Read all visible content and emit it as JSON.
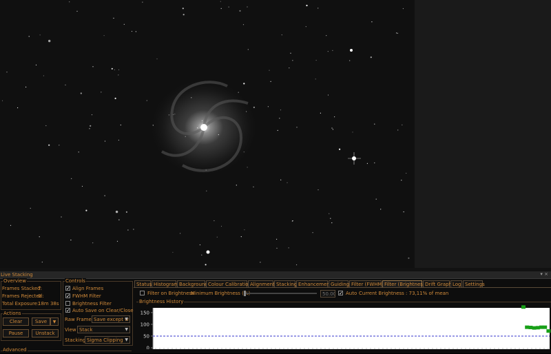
{
  "panel": {
    "title": "Live Stacking",
    "controls": "▾ ×"
  },
  "overview": {
    "title": "Overview",
    "frames_stacked_label": "Frames Stacked:",
    "frames_stacked": "7",
    "frames_rejected_label": "Frames Rejected:",
    "frames_rejected": "0",
    "total_exposure_label": "Total Exposure:",
    "total_exposure": "18m 38s"
  },
  "actions": {
    "title": "Actions",
    "clear": "Clear",
    "save": "Save",
    "pause": "Pause",
    "unstack": "Unstack"
  },
  "advanced": {
    "title": "Advanced"
  },
  "controls": {
    "title": "Controls",
    "checks": [
      {
        "label": "Align Frames",
        "checked": true
      },
      {
        "label": "FWHM Filter",
        "checked": true
      },
      {
        "label": "Brightness Filter",
        "checked": false
      },
      {
        "label": "Auto Save on Clear/Close",
        "checked": true
      }
    ],
    "raw_frames_label": "Raw Frames",
    "raw_frames_value": "Save except w",
    "view_label": "View",
    "view_value": "Stack",
    "stacking_label": "Stacking",
    "stacking_value": "Sigma Clipping"
  },
  "tabs": [
    "Status",
    "Histogram",
    "Background",
    "Colour Calibration",
    "Alignment",
    "Stacking",
    "Enhancement",
    "Guiding",
    "Filter (FWHM)",
    "Filter (Brightness)",
    "Drift Graph",
    "Log",
    "Settings"
  ],
  "active_tab": "Filter (Brightness)",
  "filter": {
    "filter_on_label": "Filter on Brightness",
    "filter_on_checked": false,
    "min_label": "Minimum Brightness (%)",
    "min_value": "50.00",
    "auto_label": "Auto",
    "auto_checked": true,
    "current": "Current Brightness : 73,11% of mean"
  },
  "history": {
    "title": "Brightness History"
  },
  "chart_data": {
    "type": "scatter",
    "title": "Brightness History",
    "xlabel": "",
    "ylabel": "",
    "y_ticks": [
      "150",
      "100",
      "50",
      "0"
    ],
    "ylim": [
      0,
      170
    ],
    "threshold": 50,
    "threshold_color": "#3333cc",
    "point_color": "#18a018",
    "series": [
      {
        "x": [
          0,
          1,
          2,
          3,
          4,
          5,
          6,
          7
        ],
        "y": [
          175,
          89,
          88,
          86,
          87,
          89,
          89,
          73
        ]
      }
    ]
  },
  "colors": {
    "accent": "#d08a3a",
    "background": "#0d0d0d"
  }
}
